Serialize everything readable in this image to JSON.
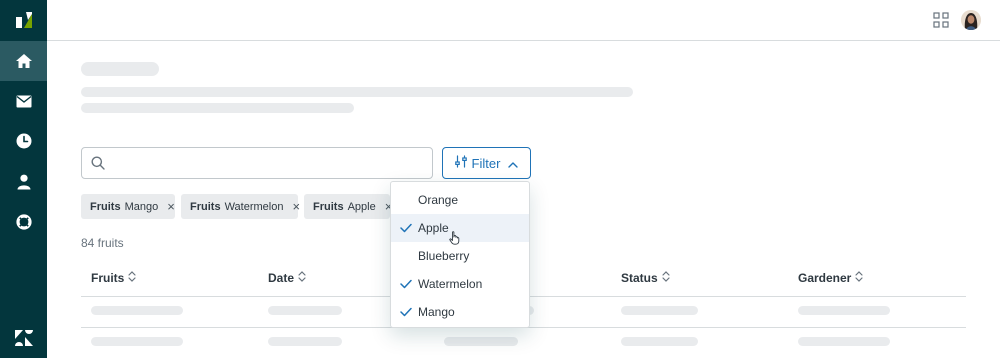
{
  "nav": {
    "items": [
      {
        "icon": "zendesk-logo-icon"
      },
      {
        "icon": "home-icon",
        "active": true
      },
      {
        "icon": "mail-icon"
      },
      {
        "icon": "clock-icon"
      },
      {
        "icon": "user-icon"
      },
      {
        "icon": "support-icon"
      },
      {
        "icon": "zendesk-z-icon"
      }
    ]
  },
  "header": {
    "apps_icon": "apps-grid-icon",
    "avatar_icon": "avatar"
  },
  "search": {
    "placeholder": "",
    "value": ""
  },
  "filter": {
    "label": "Filter",
    "expanded": true
  },
  "tags": [
    {
      "key": "Fruits",
      "value": "Mango",
      "remove": "×"
    },
    {
      "key": "Fruits",
      "value": "Watermelon",
      "remove": "×"
    },
    {
      "key": "Fruits",
      "value": "Apple",
      "remove": "×"
    }
  ],
  "results": {
    "count_label": "84 fruits"
  },
  "table": {
    "columns": [
      {
        "label": "Fruits"
      },
      {
        "label": "Date"
      },
      {
        "label": ""
      },
      {
        "label": "Status"
      },
      {
        "label": "Gardener"
      }
    ]
  },
  "dropdown": {
    "options": [
      {
        "label": "Orange",
        "checked": false
      },
      {
        "label": "Apple",
        "checked": true,
        "hovered": true
      },
      {
        "label": "Blueberry",
        "checked": false
      },
      {
        "label": "Watermelon",
        "checked": true
      },
      {
        "label": "Mango",
        "checked": true
      }
    ]
  },
  "colors": {
    "sidebar": "#03363d",
    "sidebar_active": "#2b5a62",
    "accent": "#1f73b7",
    "brand_green": "#78a300",
    "skeleton": "#e9ebed",
    "tag_bg": "#e9ebed"
  }
}
